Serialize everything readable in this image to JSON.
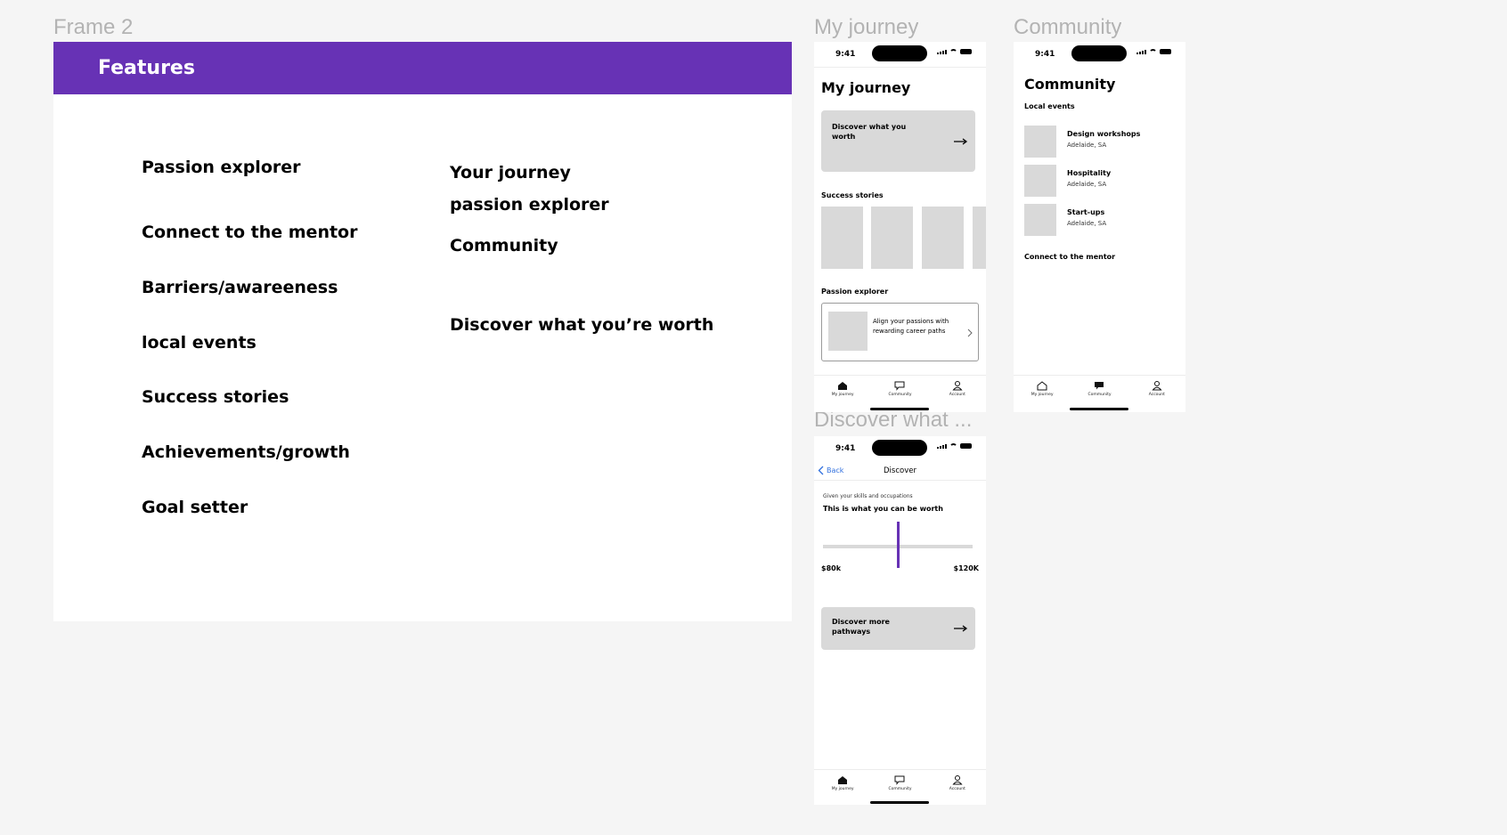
{
  "frames": {
    "frame2_label": "Frame 2",
    "journey_label": "My journey",
    "community_label": "Community",
    "discover_label": "Discover what ..."
  },
  "features": {
    "title": "Features",
    "left": [
      "Passion explorer",
      "Connect to the mentor",
      "Barriers/awareeness",
      "local events",
      "Success stories",
      "Achievements/growth",
      "Goal setter"
    ],
    "right": [
      "Your journey",
      "passion explorer",
      "Community",
      "Discover what you’re worth"
    ]
  },
  "status_time": "9:41",
  "tabs": [
    "My journey",
    "Community",
    "Account"
  ],
  "journey": {
    "title": "My journey",
    "discover_card": "Discover what you worth",
    "success_stories": "Success stories",
    "passion_explorer": "Passion explorer",
    "passion_card": "Align your passions with rewarding career paths"
  },
  "community": {
    "title": "Community",
    "local_events": "Local events",
    "events": [
      {
        "name": "Design workshops",
        "location": "Adelaide, SA"
      },
      {
        "name": "Hospitality",
        "location": "Adelaide, SA"
      },
      {
        "name": "Start-ups",
        "location": "Adelaide, SA"
      }
    ],
    "connect": "Connect to the mentor"
  },
  "discover": {
    "back": "Back",
    "nav_title": "Discover",
    "subtitle": "Given your skills and occupations",
    "headline": "This is what you can be worth",
    "min_label": "$80k",
    "max_label": "$120K",
    "marker_fraction": 0.5,
    "more_card": "Discover more pathways"
  },
  "colors": {
    "accent": "#6732b5",
    "link": "#2f6fde"
  }
}
